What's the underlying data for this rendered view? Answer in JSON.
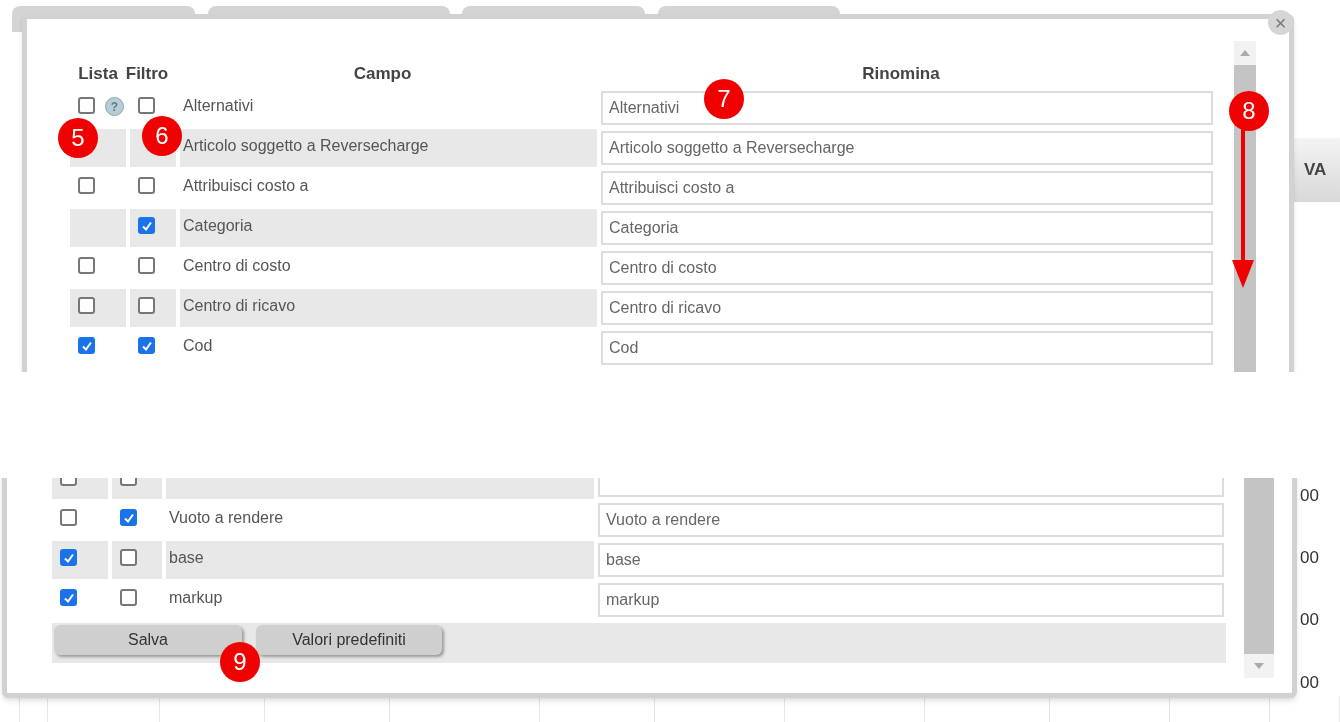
{
  "top_view": {
    "close": "×",
    "background_header": "VA",
    "columns": [
      "Lista",
      "Filtro",
      "Campo",
      "Rinomina"
    ],
    "rows": [
      {
        "field": "Alternativi",
        "rename": "Alternativi",
        "lista": false,
        "filtro": false,
        "help": "?"
      },
      {
        "field": "Articolo soggetto a Reversecharge",
        "rename": "Articolo soggetto a Reversecharge"
      },
      {
        "field": "Attribuisci costo a",
        "rename": "Attribuisci costo a",
        "lista": false,
        "filtro": false
      },
      {
        "field": "Categoria",
        "rename": "Categoria",
        "filtro": true
      },
      {
        "field": "Centro di costo",
        "rename": "Centro di costo",
        "lista": false,
        "filtro": false
      },
      {
        "field": "Centro di ricavo",
        "rename": "Centro di ricavo",
        "lista": false,
        "filtro": false
      },
      {
        "field": "Cod",
        "rename": "Cod",
        "lista": true,
        "filtro": true
      }
    ],
    "callouts": [
      "5",
      "6",
      "7",
      "8"
    ]
  },
  "bottom_view": {
    "background_values": [
      "00",
      "00",
      "00",
      "00"
    ],
    "rows": [
      {
        "lista": false,
        "filtro": false
      },
      {
        "field": "Vuoto a rendere",
        "rename": "Vuoto a rendere",
        "lista": false,
        "filtro": true
      },
      {
        "field": "base",
        "rename": "base",
        "lista": true,
        "filtro": false
      },
      {
        "field": "markup",
        "rename": "markup",
        "lista": true,
        "filtro": false
      }
    ],
    "buttons": [
      "Salva",
      "Valori predefiniti"
    ],
    "callouts": [
      "9"
    ]
  }
}
